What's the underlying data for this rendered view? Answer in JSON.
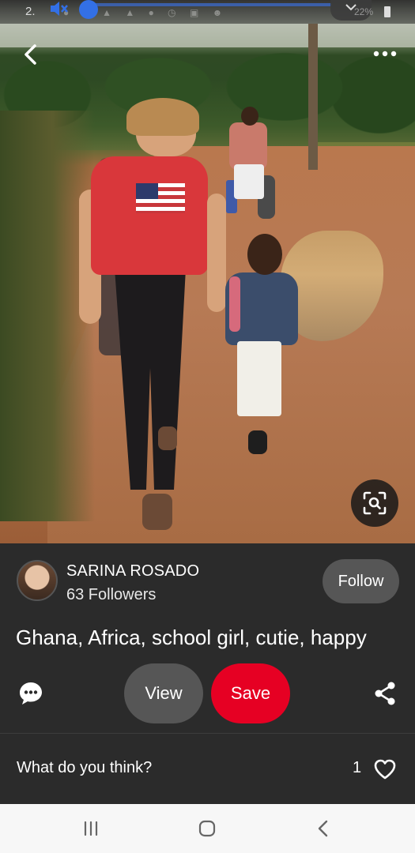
{
  "status_bar": {
    "time": "2.",
    "battery": "22%"
  },
  "photo": {
    "back_icon": "chevron-left-icon",
    "more_icon": "more-horizontal-icon",
    "lens_icon": "visual-search-icon"
  },
  "author": {
    "name": "SARINA ROSADO",
    "followers": "63 Followers",
    "follow_label": "Follow"
  },
  "pin": {
    "title": "Ghana, Africa, school girl, cutie, happy"
  },
  "actions": {
    "comment_icon": "comment-bubble-icon",
    "view_label": "View",
    "save_label": "Save",
    "share_icon": "share-icon",
    "save_color": "#e60023"
  },
  "comments": {
    "prompt": "What do you think?",
    "like_count": "1",
    "heart_icon": "heart-outline-icon"
  },
  "nav": {
    "recent_icon": "recent-apps-icon",
    "home_icon": "home-icon",
    "back_icon": "back-icon"
  }
}
